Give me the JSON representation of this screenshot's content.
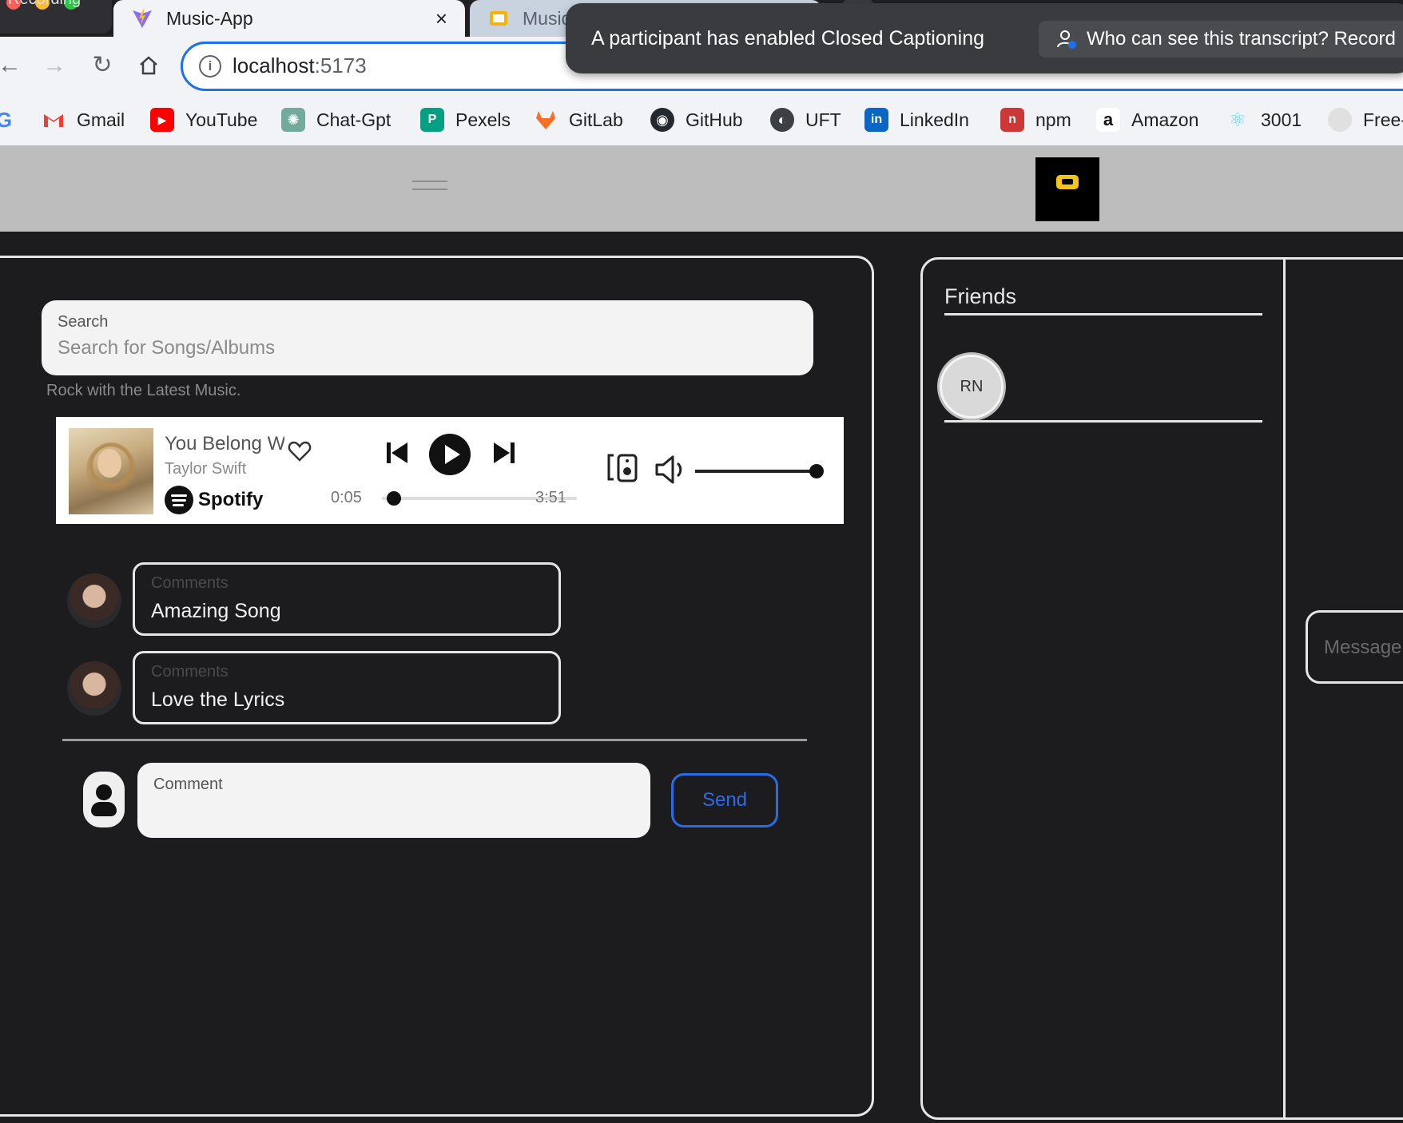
{
  "browser": {
    "recording_label": "Recording",
    "tabs": [
      {
        "title": "Music-App",
        "close": "×"
      },
      {
        "title": "Music App - Google Slides",
        "close": "×"
      }
    ],
    "new_tab": "+",
    "url_host": "localhost",
    "url_port": ":5173",
    "bookmarks": [
      {
        "label": "Gmail",
        "icon": "gmail-icon",
        "color": "#ea4335"
      },
      {
        "label": "YouTube",
        "icon": "youtube-icon",
        "color": "#ff0000"
      },
      {
        "label": "Chat-Gpt",
        "icon": "chatgpt-icon",
        "color": "#74aa9c"
      },
      {
        "label": "Pexels",
        "icon": "pexels-icon",
        "color": "#05a081"
      },
      {
        "label": "GitLab",
        "icon": "gitlab-icon",
        "color": "#fc6d26"
      },
      {
        "label": "GitHub",
        "icon": "github-icon",
        "color": "#24292f"
      },
      {
        "label": "UFT",
        "icon": "globe-icon",
        "color": "#3c4043"
      },
      {
        "label": "LinkedIn",
        "icon": "linkedin-icon",
        "color": "#0a66c2"
      },
      {
        "label": "npm",
        "icon": "npm-icon",
        "color": "#cb3837"
      },
      {
        "label": "Amazon",
        "icon": "amazon-icon",
        "color": "#111111"
      },
      {
        "label": "3001",
        "icon": "react-icon",
        "color": "#61dafb"
      },
      {
        "label": "Free-",
        "icon": "github-icon",
        "color": "#e0e0e0"
      }
    ]
  },
  "toast": {
    "message": "A participant has enabled Closed Captioning",
    "link": "Who can see this transcript? Record"
  },
  "search": {
    "label": "Search",
    "placeholder": "Search for Songs/Albums",
    "helper": "Rock with the Latest Music."
  },
  "player": {
    "title": "You Belong With Me",
    "artist": "Taylor Swift",
    "provider": "Spotify",
    "current_time": "0:05",
    "duration": "3:51",
    "volume": 1.0
  },
  "comments": [
    {
      "label": "Comments",
      "text": "Amazing Song"
    },
    {
      "label": "Comments",
      "text": "Love the Lyrics"
    }
  ],
  "composer": {
    "label": "Comment",
    "send": "Send"
  },
  "friends": {
    "title": "Friends",
    "items": [
      {
        "initials": "RN"
      }
    ]
  },
  "chat": {
    "placeholder": "Message"
  },
  "colors": {
    "accent": "#2b6be6",
    "background": "#1c1c1f",
    "header": "#bebdbe"
  }
}
